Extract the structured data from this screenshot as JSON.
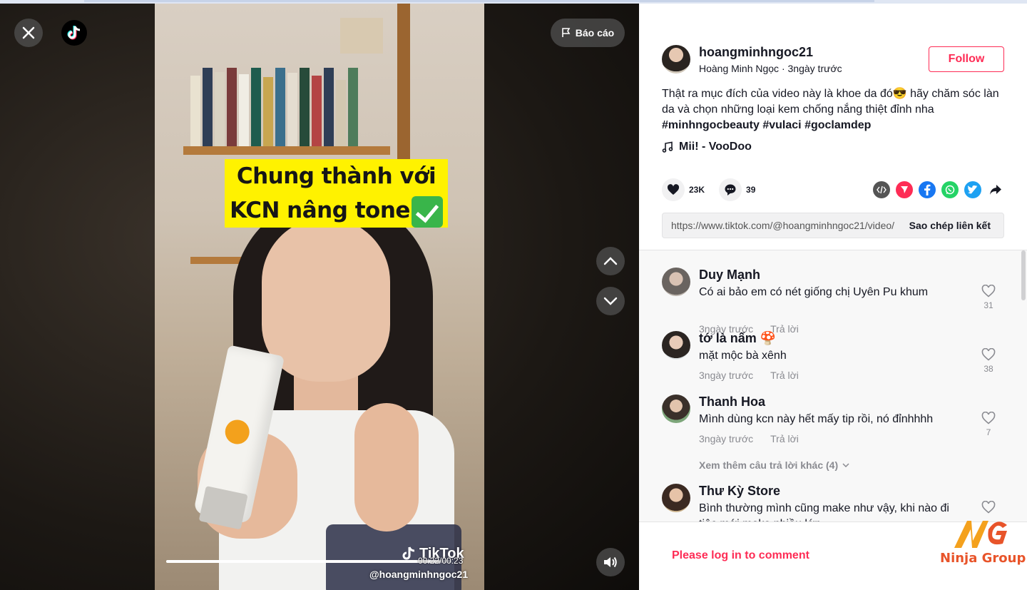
{
  "video": {
    "caption_line1": "Chung thành với",
    "caption_line2": "KCN nâng tone",
    "report_label": "Báo cáo",
    "watermark": "TikTok",
    "watermark_handle": "@hoangminhngoc21",
    "time": "00:22/00:23",
    "progress_fraction": 0.96
  },
  "author": {
    "username": "hoangminhngoc21",
    "display_name": "Hoàng Minh Ngọc",
    "posted": "3ngày trước",
    "follow_label": "Follow"
  },
  "description": {
    "text": "Thật ra mục đích của video này là khoe da đó😎 hãy chăm sóc làn da và chọn những loại kem chống nắng thiệt đỉnh nha",
    "hashtags": [
      "#minhngocbeauty",
      "#vulaci",
      "#goclamdep"
    ]
  },
  "music": "Mii! - VooDoo",
  "stats": {
    "likes": "23K",
    "comments": "39"
  },
  "share": {
    "icons": [
      "embed-icon",
      "send-icon",
      "facebook-icon",
      "whatsapp-icon",
      "twitter-icon",
      "share-arrow-icon"
    ],
    "colors": {
      "send": "#fe2c55",
      "facebook": "#1877f2",
      "whatsapp": "#25d366",
      "twitter": "#1da1f2",
      "embed": "#545454"
    }
  },
  "link": {
    "url": "https://www.tiktok.com/@hoangminhngoc21/video/",
    "copy_label": "Sao chép liên kết"
  },
  "comments": [
    {
      "name": "Duy Mạnh",
      "text": "Có ai bảo em có nét giống chị Uyên Pu khum",
      "time": "3ngày trước",
      "reply": "Trả lời",
      "likes": "31"
    },
    {
      "name": "tớ là nấm 🍄",
      "text": "mặt mộc bà xênh",
      "time": "3ngày trước",
      "reply": "Trả lời",
      "likes": "38"
    },
    {
      "name": "Thanh Hoa",
      "text": "Mình dùng kcn này hết mấy tip rồi, nó đỉnhhhh",
      "time": "3ngày trước",
      "reply": "Trả lời",
      "likes": "7"
    },
    {
      "name": "Thư Kỳ Store",
      "text": "Bình thường mình cũng make như vậy, khi nào đi tiệc mới make nhiều lớp",
      "time": "",
      "reply": "",
      "likes": ""
    }
  ],
  "more_replies": "Xem thêm câu trả lời khác (4)",
  "login_prompt": "Please log in to comment",
  "brand_watermark": "Ninja Group",
  "colors": {
    "accent": "#fe2c55",
    "text": "#161823",
    "muted": "#8a8b91"
  }
}
